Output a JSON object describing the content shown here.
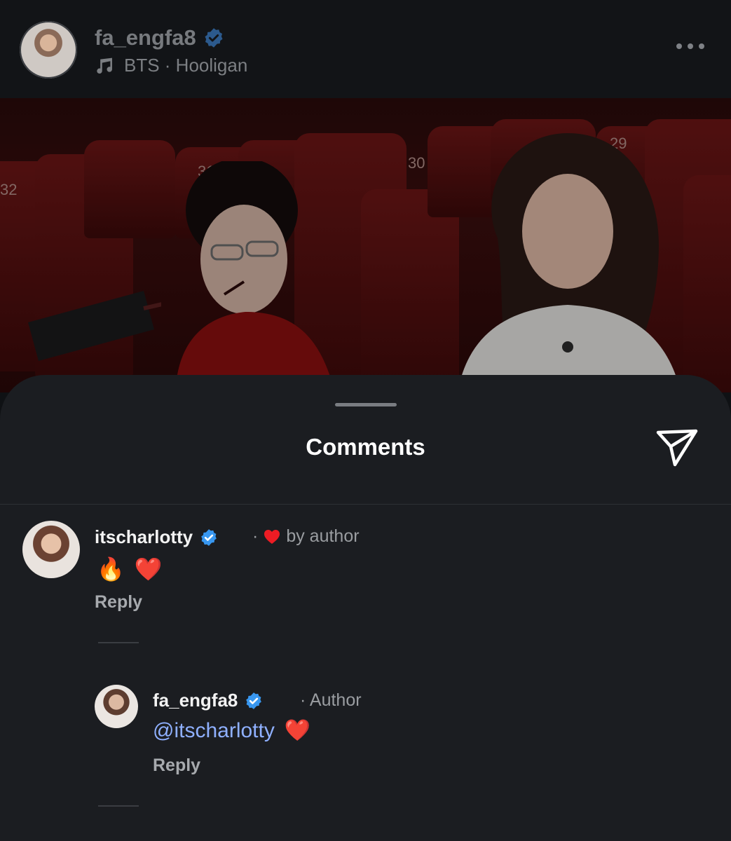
{
  "header": {
    "username": "fa_engfa8",
    "music": "BTS · Hooligan"
  },
  "photo": {
    "seat_numbers": [
      "32",
      "31",
      "30",
      "29"
    ]
  },
  "sheet": {
    "title": "Comments"
  },
  "comments": [
    {
      "username": "itscharlotty",
      "meta_prefix": "·",
      "meta": "by author",
      "text_emoji_1": "🔥",
      "text_emoji_2": "❤️",
      "reply_label": "Reply"
    },
    {
      "username": "fa_engfa8",
      "meta": "· Author",
      "mention": "@itscharlotty",
      "text_emoji": "❤️",
      "reply_label": "Reply"
    }
  ],
  "colors": {
    "accent_verified": "#3897f0",
    "heart": "#ed1c24",
    "mention": "#8fb0ff"
  }
}
